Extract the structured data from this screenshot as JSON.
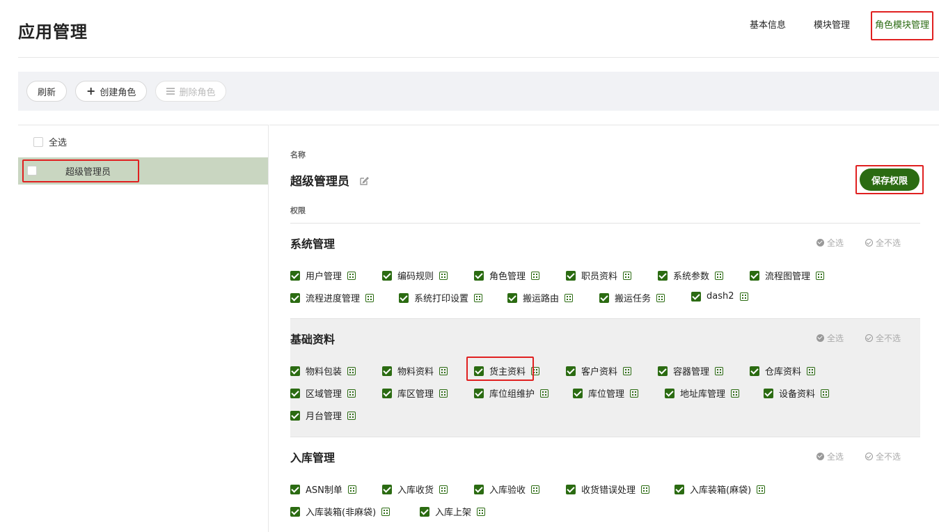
{
  "header": {
    "title": "应用管理",
    "nav": [
      "基本信息",
      "模块管理",
      "角色模块管理"
    ],
    "active_nav": "角色模块管理"
  },
  "toolbar": {
    "refresh": "刷新",
    "create_role": "创建角色",
    "delete_role": "删除角色"
  },
  "left": {
    "select_all": "全选",
    "roles": [
      {
        "name": "超级管理员"
      }
    ]
  },
  "detail": {
    "name_label": "名称",
    "role_name": "超级管理员",
    "perm_label": "权限",
    "save_button": "保存权限",
    "select_all": "全选",
    "select_none": "全不选",
    "sections": [
      {
        "title": "系统管理",
        "items": [
          "用户管理",
          "编码规则",
          "角色管理",
          "职员资料",
          "系统参数",
          "流程图管理",
          "流程进度管理",
          "系统打印设置",
          "搬运路由",
          "搬运任务",
          "dash2"
        ]
      },
      {
        "title": "基础资料",
        "items": [
          "物料包装",
          "物料资料",
          "货主资料",
          "客户资料",
          "容器管理",
          "仓库资料",
          "区域管理",
          "库区管理",
          "库位组维护",
          "库位管理",
          "地址库管理",
          "设备资料",
          "月台管理"
        ]
      },
      {
        "title": "入库管理",
        "items": [
          "ASN制单",
          "入库收货",
          "入库验收",
          "收货错误处理",
          "入库装箱(麻袋)",
          "入库装箱(非麻袋)",
          "入库上架"
        ]
      }
    ]
  },
  "colors": {
    "accent_green": "#2b6b12",
    "highlight_red": "#e02020",
    "selected_row": "#c9d6c1"
  }
}
